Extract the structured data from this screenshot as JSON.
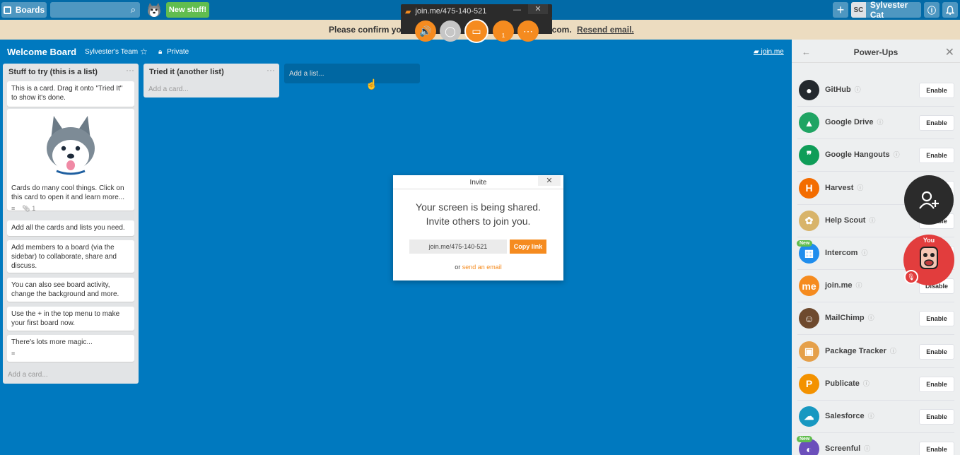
{
  "topbar": {
    "boards_label": "Boards",
    "new_stuff_label": "New stuff!",
    "plus_label": "+",
    "user_initials": "SC",
    "user_name": "Sylvester Cat",
    "info_label": "ⓘ",
    "bell_label": "🔔"
  },
  "banner": {
    "text_start": "Please confirm you",
    "text_end": "lus.com.",
    "resend_label": "Resend email."
  },
  "joinme_toolbar": {
    "title": "join.me/475-140-521",
    "minimize": "—",
    "close": "✕",
    "participant_count": "1"
  },
  "board": {
    "title": "Welcome Board",
    "team": "Sylvester's Team",
    "visibility": "Private",
    "joinme_link": "join.me"
  },
  "lists": [
    {
      "title": "Stuff to try (this is a list)",
      "cards": [
        "This is a card. Drag it onto \"Tried It\" to show it's done.",
        "Cards do many cool things. Click on this card to open it and learn more...",
        "Add all the cards and lists you need.",
        "Add members to a board (via the sidebar) to collaborate, share and discuss.",
        "You can also see board activity, change the background and more.",
        "Use the + in the top menu to make your first board now.",
        "There's lots more magic..."
      ],
      "attachment_count": "1",
      "add_card": "Add a card..."
    },
    {
      "title": "Tried it (another list)",
      "cards": [],
      "add_card": "Add a card..."
    }
  ],
  "add_list": "Add a list...",
  "invite": {
    "title": "Invite",
    "close": "✕",
    "message_line1": "Your screen is being shared.",
    "message_line2": "Invite others to join you.",
    "url": "join.me/475-140-521",
    "copy_label": "Copy link",
    "or_text": "or",
    "email_link": "send an email"
  },
  "powerups": {
    "title": "Power-Ups",
    "back": "←",
    "close": "✕",
    "items": [
      {
        "name": "GitHub",
        "button": "Enable",
        "color": "#24292e",
        "glyph": "●"
      },
      {
        "name": "Google Drive",
        "button": "Enable",
        "color": "#1fa463",
        "glyph": "▲"
      },
      {
        "name": "Google Hangouts",
        "button": "Enable",
        "color": "#0f9d58",
        "glyph": "❞"
      },
      {
        "name": "Harvest",
        "button": "Enable",
        "color": "#f36c00",
        "glyph": "H"
      },
      {
        "name": "Help Scout",
        "button": "Enable",
        "color": "#d8b46a",
        "glyph": "✿"
      },
      {
        "name": "Intercom",
        "button": "Enable",
        "color": "#1f8ded",
        "glyph": "▦",
        "new": "New"
      },
      {
        "name": "join.me",
        "button": "Disable",
        "color": "#f58b1f",
        "glyph": "me"
      },
      {
        "name": "MailChimp",
        "button": "Enable",
        "color": "#6e4a2e",
        "glyph": "☺"
      },
      {
        "name": "Package Tracker",
        "button": "Enable",
        "color": "#e5a04a",
        "glyph": "▣"
      },
      {
        "name": "Publicate",
        "button": "Enable",
        "color": "#f39200",
        "glyph": "P"
      },
      {
        "name": "Salesforce",
        "button": "Enable",
        "color": "#1798c1",
        "glyph": "☁"
      },
      {
        "name": "Screenful",
        "button": "Enable",
        "color": "#6b4fbb",
        "glyph": "◐",
        "new": "New"
      }
    ]
  },
  "overlay": {
    "add_participant": "+",
    "you_label": "You"
  }
}
